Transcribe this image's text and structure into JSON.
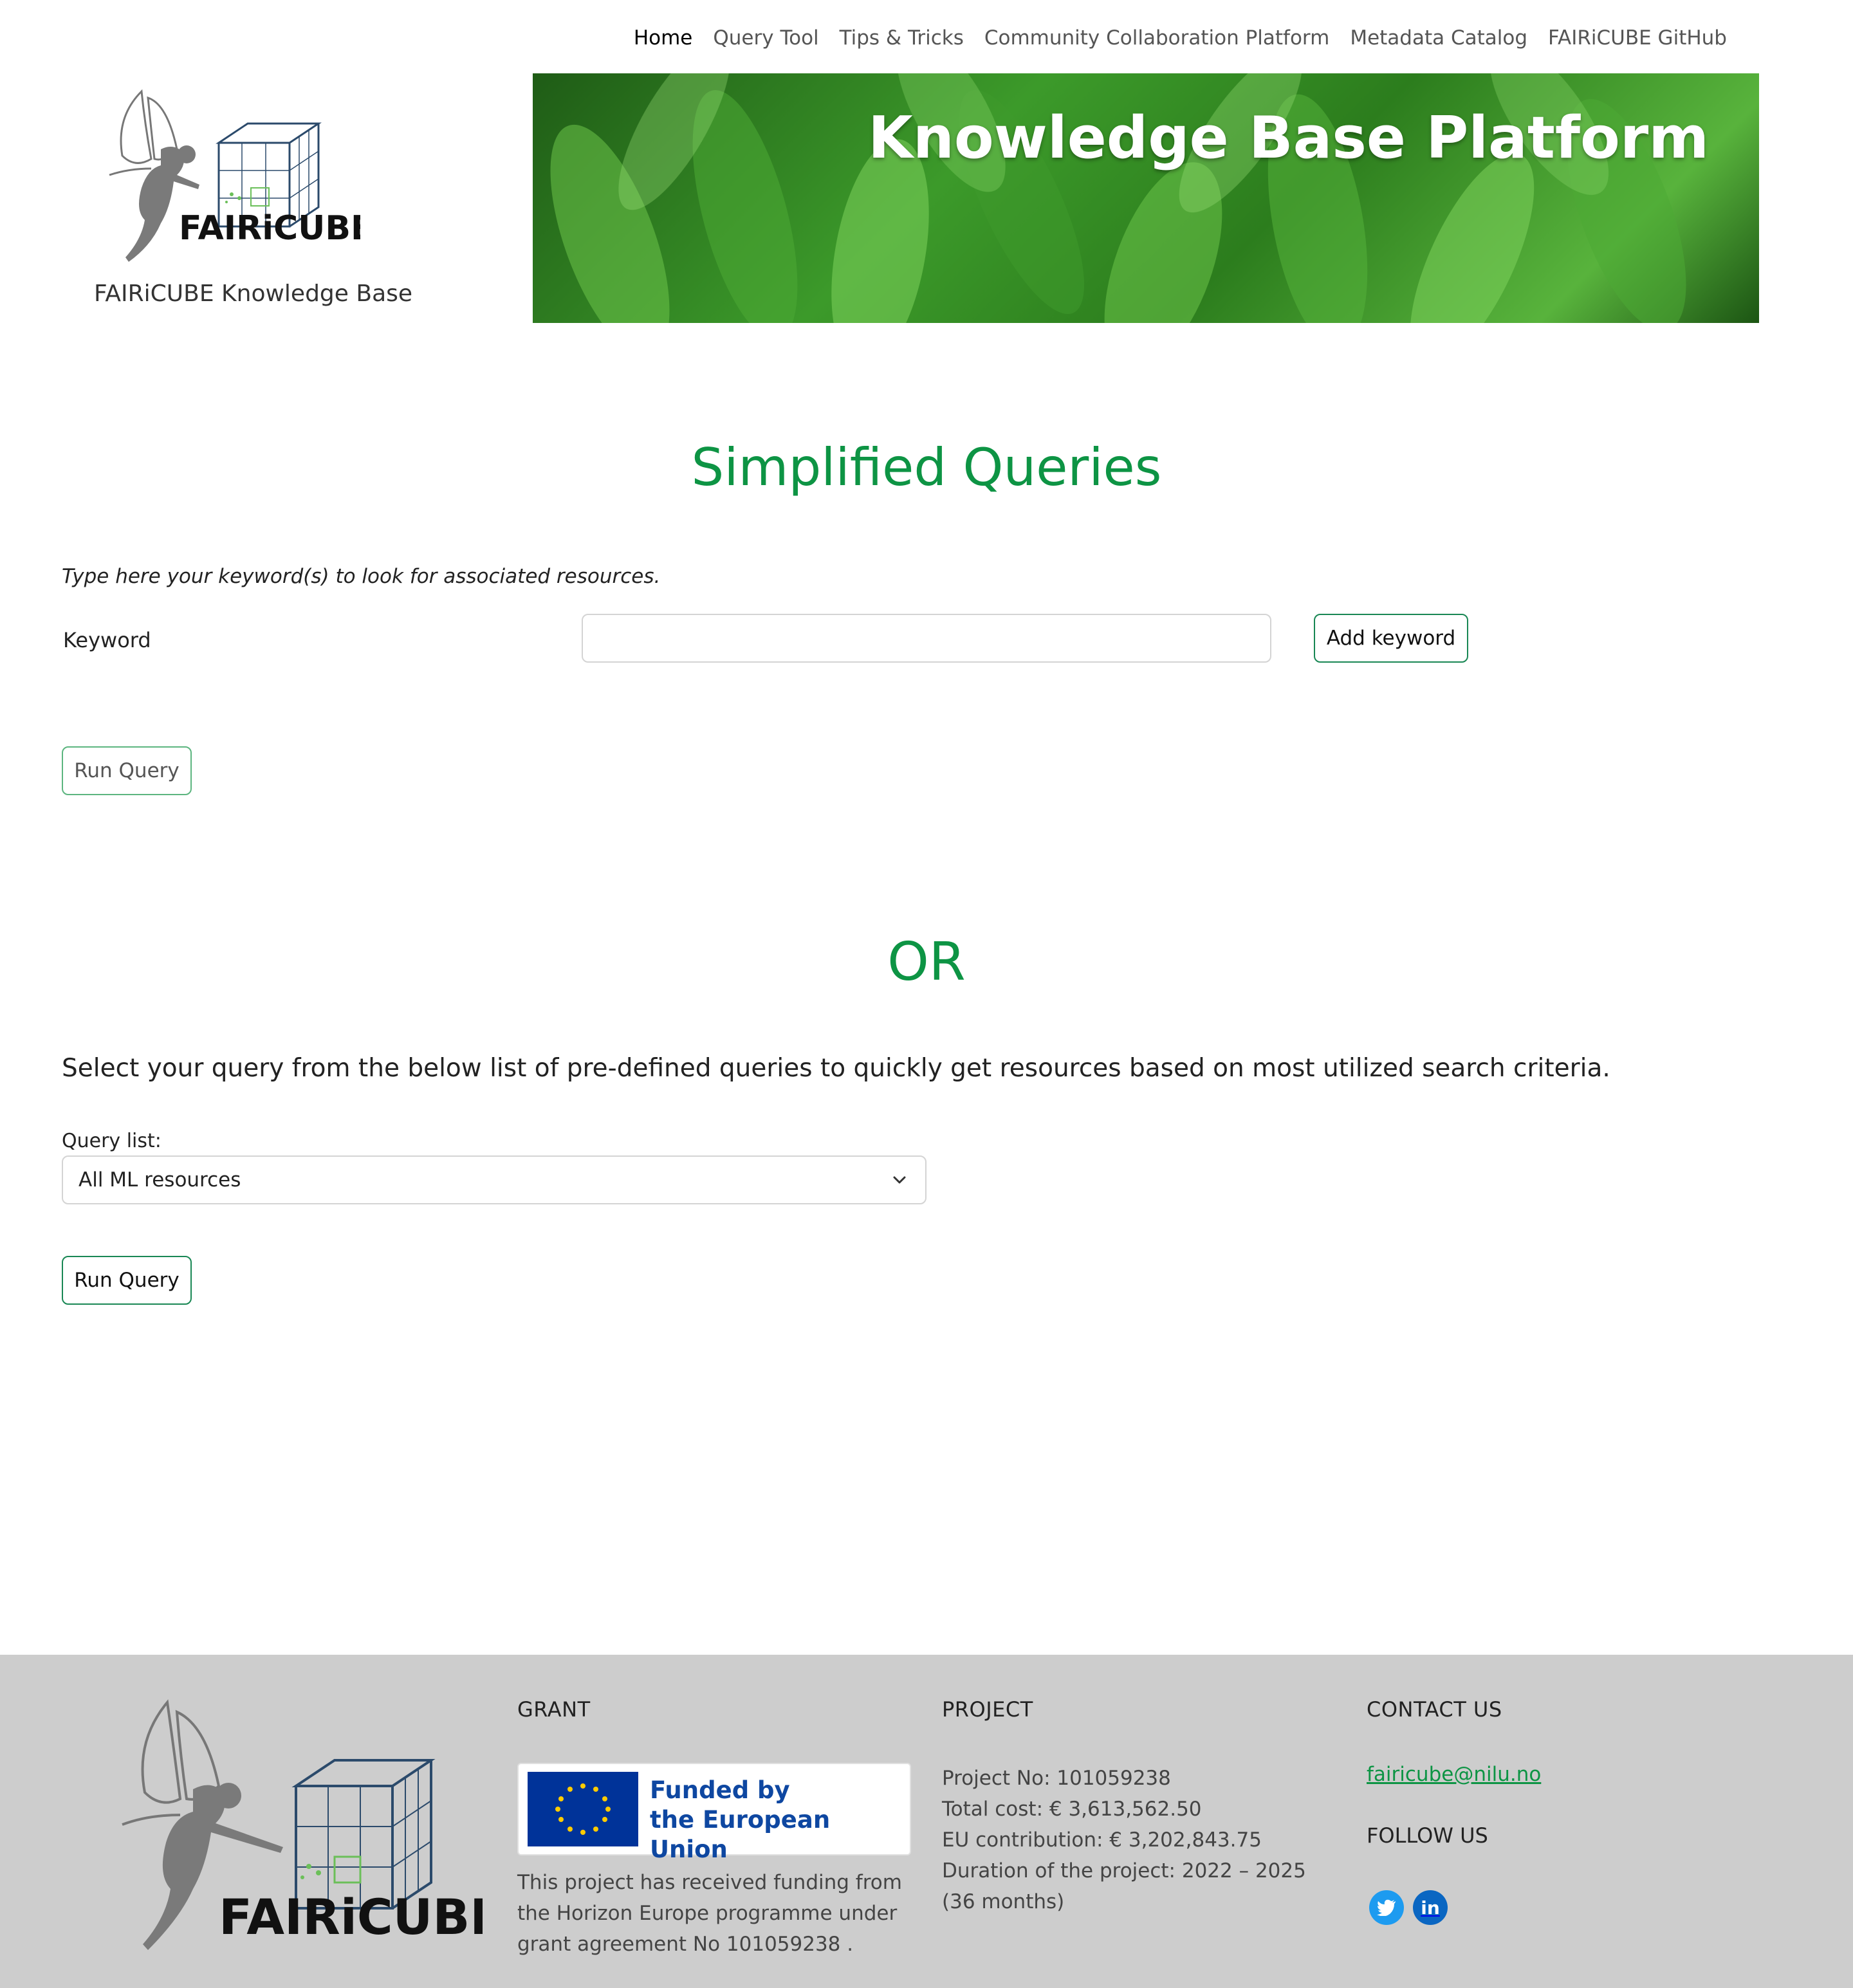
{
  "nav": {
    "items": [
      {
        "label": "Home",
        "active": true
      },
      {
        "label": "Query Tool"
      },
      {
        "label": "Tips & Tricks"
      },
      {
        "label": "Community Collaboration Platform"
      },
      {
        "label": "Metadata Catalog"
      },
      {
        "label": "FAIRiCUBE GitHub"
      }
    ]
  },
  "header": {
    "logo_text": "FAIRiCUBE",
    "logo_caption": "FAIRiCUBE Knowledge Base",
    "banner_title": "Knowledge Base Platform"
  },
  "simplified": {
    "title": "Simplified Queries",
    "instruction": "Type here your keyword(s) to look for associated resources.",
    "keyword_label": "Keyword",
    "keyword_value": "",
    "add_button": "Add keyword",
    "run_button": "Run Query"
  },
  "or_title": "OR",
  "predefined": {
    "intro": "Select your query from the below list of pre-defined queries to quickly get resources based on most utilized search criteria.",
    "list_label": "Query list:",
    "selected": "All ML resources",
    "run_button": "Run Query"
  },
  "footer": {
    "grant_heading": "GRANT",
    "eu_line1": "Funded by",
    "eu_line2": "the European Union",
    "grant_text": "This project has received funding from the Horizon Europe programme under grant agreement No 101059238 .",
    "project_heading": "PROJECT",
    "project_no": "Project No: 101059238",
    "total_cost": "Total cost: € 3,613,562.50",
    "eu_contribution": "EU contribution: € 3,202,843.75",
    "duration": "Duration of the project: 2022 – 2025 (36 months)",
    "contact_heading": "CONTACT US",
    "email": "fairicube@nilu.no",
    "follow_heading": "FOLLOW US",
    "social": [
      "twitter-icon",
      "linkedin-icon"
    ]
  },
  "colors": {
    "accent_green": "#0d9444",
    "footer_bg": "#cdcdcd",
    "eu_blue": "#003399"
  }
}
